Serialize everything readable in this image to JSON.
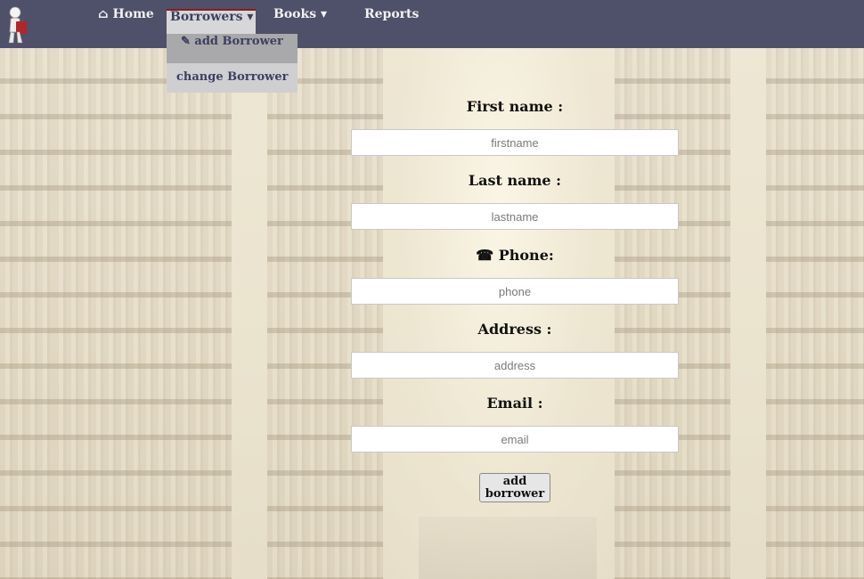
{
  "nav": {
    "home_label": "⌂ Home",
    "borrowers_label": "Borrowers ▾",
    "books_label": "Books ▾",
    "reports_label": "Reports"
  },
  "borrowers_menu": {
    "add_label": "✎ add Borrower",
    "change_label": "change Borrower"
  },
  "form": {
    "first_name_label": "First name :",
    "first_name_placeholder": "firstname",
    "last_name_label": "Last name :",
    "last_name_placeholder": "lastname",
    "phone_label": "☎ Phone:",
    "phone_placeholder": "phone",
    "address_label": "Address :",
    "address_placeholder": "address",
    "email_label": "Email :",
    "email_placeholder": "email",
    "submit_label": "add borrower"
  },
  "colors": {
    "navbar": "#4f5069",
    "active_tab_accent": "#8c1d1d",
    "dropdown": "#cfcfd2"
  },
  "icons": {
    "logo": "reader-figure-logo",
    "home": "home-icon",
    "phone": "phone-icon",
    "edit": "pencil-icon"
  }
}
